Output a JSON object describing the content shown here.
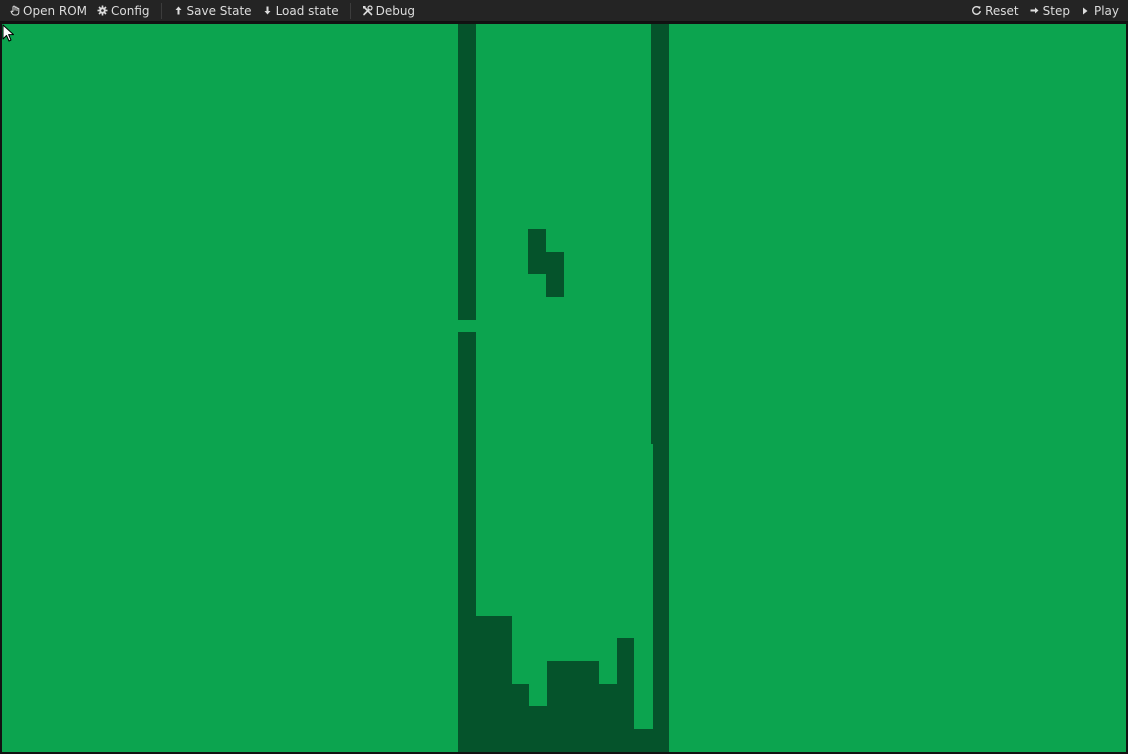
{
  "toolbar": {
    "left_groups": [
      [
        {
          "name": "open-rom-button",
          "icon": "open-rom-icon",
          "label": "Open ROM"
        },
        {
          "name": "config-button",
          "icon": "gear-icon",
          "label": "Config"
        }
      ],
      [
        {
          "name": "save-state-button",
          "icon": "arrow-up-icon",
          "label": "Save State"
        },
        {
          "name": "load-state-button",
          "icon": "arrow-down-icon",
          "label": "Load state"
        }
      ],
      [
        {
          "name": "debug-button",
          "icon": "tools-icon",
          "label": "Debug"
        }
      ]
    ],
    "right_items": [
      {
        "name": "reset-button",
        "icon": "reset-icon",
        "label": "Reset"
      },
      {
        "name": "step-button",
        "icon": "arrow-right-icon",
        "label": "Step"
      },
      {
        "name": "play-button",
        "icon": "play-icon",
        "label": "Play"
      }
    ]
  },
  "screen": {
    "colors": {
      "background": "#0ca44f",
      "foreground": "#05532b",
      "toolbar_bg": "#242424",
      "toolbar_text": "#dcdcdc"
    }
  }
}
